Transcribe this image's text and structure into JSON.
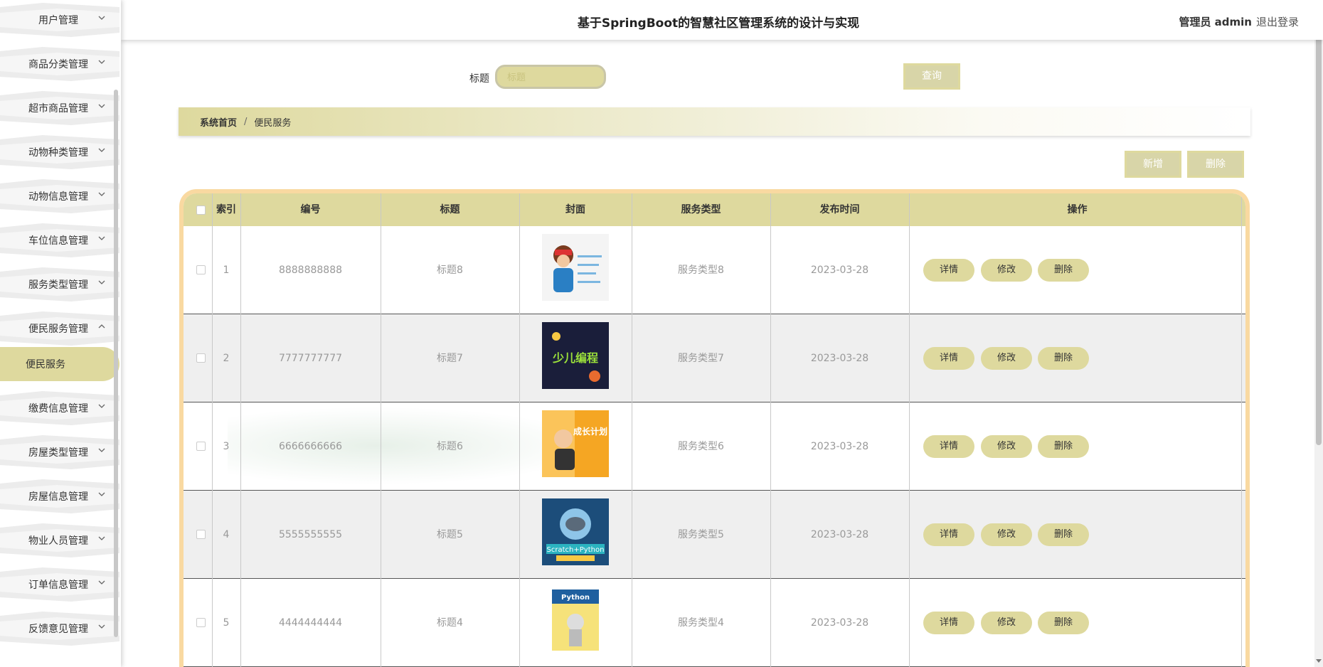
{
  "header": {
    "title": "基于SpringBoot的智慧社区管理系统的设计与实现",
    "admin": "管理员 admin",
    "logout": "退出登录"
  },
  "sidebar": {
    "items": [
      {
        "label": "用户管理"
      },
      {
        "label": "商品分类管理"
      },
      {
        "label": "超市商品管理"
      },
      {
        "label": "动物种类管理"
      },
      {
        "label": "动物信息管理"
      },
      {
        "label": "车位信息管理"
      },
      {
        "label": "服务类型管理"
      },
      {
        "label": "便民服务管理"
      },
      {
        "label": "缴费信息管理"
      },
      {
        "label": "房屋类型管理"
      },
      {
        "label": "房屋信息管理"
      },
      {
        "label": "物业人员管理"
      },
      {
        "label": "订单信息管理"
      },
      {
        "label": "反馈意见管理"
      }
    ],
    "active_sub": "便民服务"
  },
  "search": {
    "label": "标题",
    "placeholder": "标题",
    "button": "查询"
  },
  "breadcrumb": {
    "home": "系统首页",
    "sep": "/",
    "current": "便民服务"
  },
  "actions": {
    "add": "新增",
    "delete": "删除"
  },
  "table": {
    "headers": [
      "索引",
      "编号",
      "标题",
      "封面",
      "服务类型",
      "发布时间",
      "操作"
    ],
    "rows": [
      {
        "index": "1",
        "code": "8888888888",
        "title": "标题8",
        "type": "服务类型8",
        "time": "2023-03-28"
      },
      {
        "index": "2",
        "code": "7777777777",
        "title": "标题7",
        "type": "服务类型7",
        "time": "2023-03-28"
      },
      {
        "index": "3",
        "code": "6666666666",
        "title": "标题6",
        "type": "服务类型6",
        "time": "2023-03-28"
      },
      {
        "index": "4",
        "code": "5555555555",
        "title": "标题5",
        "type": "服务类型5",
        "time": "2023-03-28"
      },
      {
        "index": "5",
        "code": "4444444444",
        "title": "标题4",
        "type": "服务类型4",
        "time": "2023-03-28"
      }
    ],
    "ops": {
      "detail": "详情",
      "edit": "修改",
      "delete": "删除"
    },
    "cover_texts": {
      "row2": "少儿编程",
      "row3": "成长计划",
      "row4": "Scratch+Python",
      "row5": "Python"
    }
  },
  "colors": {
    "accent": "#ded99e",
    "table_border": "#f9d9a1",
    "row_alt": "#efefef"
  }
}
